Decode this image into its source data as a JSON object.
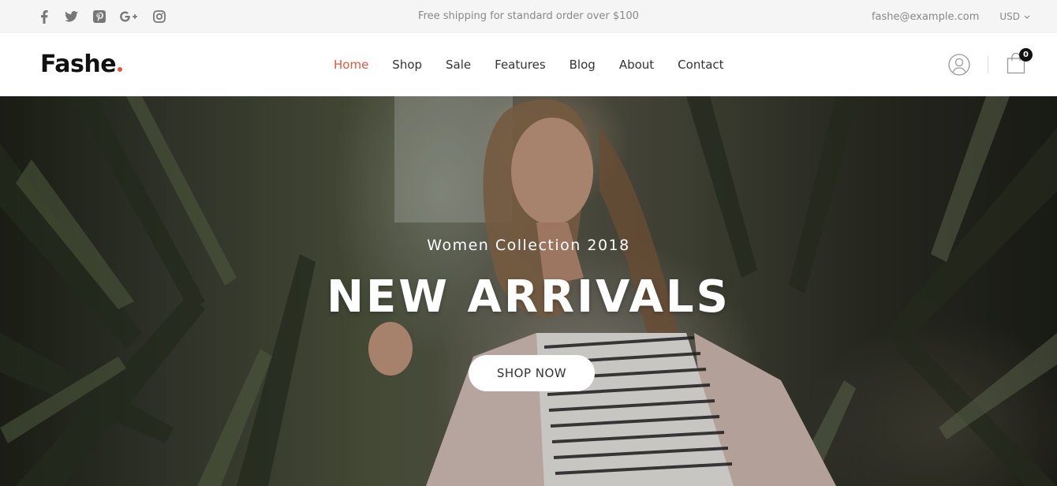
{
  "topbar": {
    "social": [
      "facebook-icon",
      "twitter-icon",
      "pinterest-icon",
      "google-plus-icon",
      "instagram-icon"
    ],
    "message": "Free shipping for standard order over $100",
    "email": "fashe@example.com",
    "currency": "USD"
  },
  "header": {
    "logo": "Fashe",
    "nav": {
      "home": "Home",
      "shop": "Shop",
      "sale": "Sale",
      "features": "Features",
      "blog": "Blog",
      "about": "About",
      "contact": "Contact"
    },
    "active_nav": "Home",
    "cart_count": "0"
  },
  "hero": {
    "subtitle": "Women Collection 2018",
    "title": "NEW ARRIVALS",
    "button": "SHOP NOW"
  },
  "colors": {
    "accent": "#e65540",
    "topbar_bg": "#f5f5f5",
    "text": "#333333",
    "muted": "#888888"
  }
}
